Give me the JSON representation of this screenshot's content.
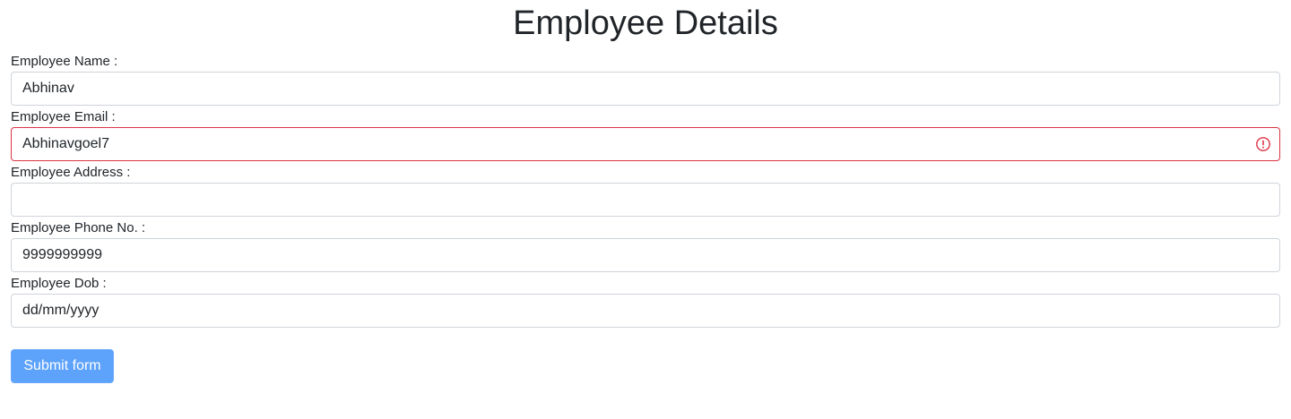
{
  "title": "Employee Details",
  "fields": [
    {
      "label": "Employee Name :",
      "value": "Abhinav",
      "placeholder": "",
      "invalid": false
    },
    {
      "label": "Employee Email :",
      "value": "Abhinavgoel7",
      "placeholder": "",
      "invalid": true
    },
    {
      "label": "Employee Address :",
      "value": "",
      "placeholder": "",
      "invalid": false
    },
    {
      "label": "Employee Phone No. :",
      "value": "9999999999",
      "placeholder": "",
      "invalid": false
    },
    {
      "label": "Employee Dob :",
      "value": "",
      "placeholder": "dd/mm/yyyy",
      "invalid": false
    }
  ],
  "submit_label": "Submit form",
  "colors": {
    "error": "#dc3545",
    "button_bg": "#5da2fb",
    "border": "#ced4da",
    "text": "#212529"
  },
  "icons": {
    "email_error": "exclamation-circle-icon"
  }
}
